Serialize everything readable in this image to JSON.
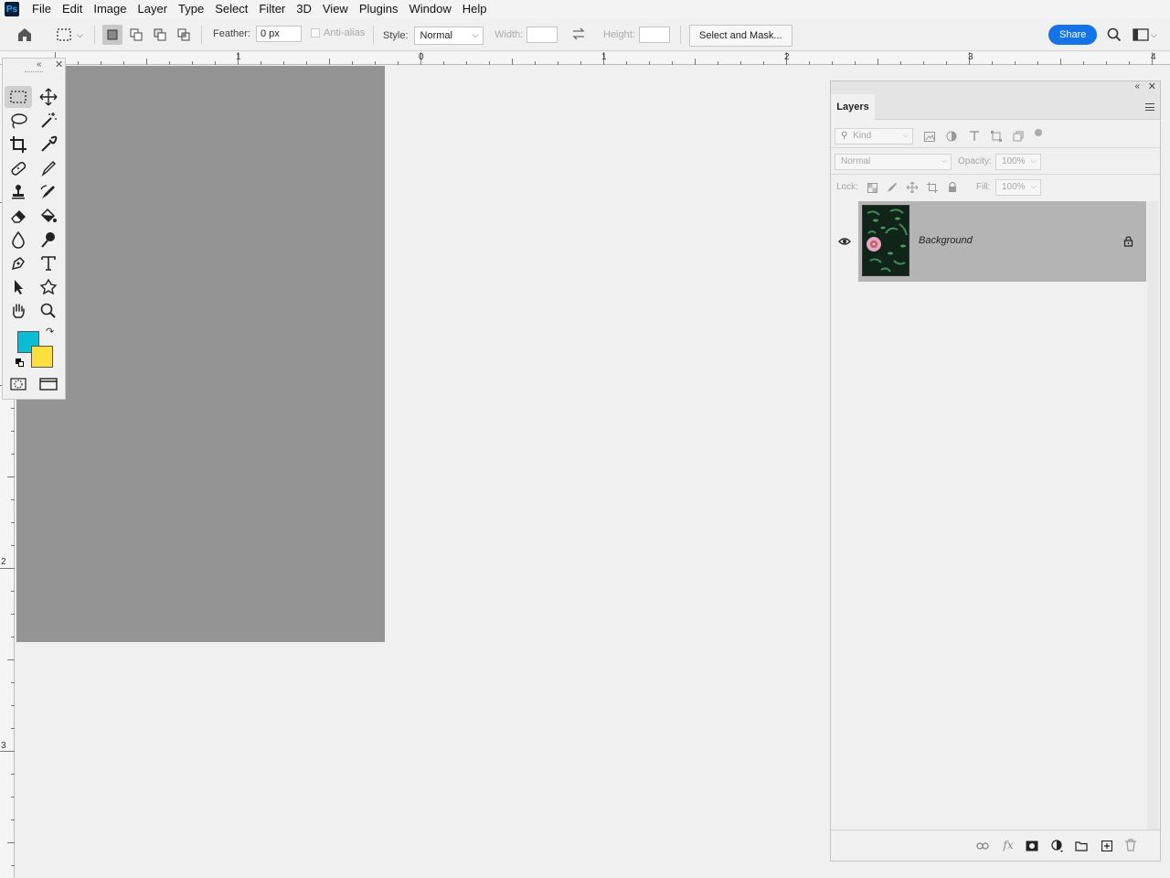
{
  "app": {
    "logo_text": "Ps"
  },
  "menu": [
    "File",
    "Edit",
    "Image",
    "Layer",
    "Type",
    "Select",
    "Filter",
    "3D",
    "View",
    "Plugins",
    "Window",
    "Help"
  ],
  "options": {
    "feather_label": "Feather:",
    "feather_value": "0 px",
    "antialias_label": "Anti-alias",
    "style_label": "Style:",
    "style_value": "Normal",
    "width_label": "Width:",
    "height_label": "Height:",
    "select_mask_label": "Select and Mask...",
    "share_label": "Share"
  },
  "rulers": {
    "top": [
      "1",
      "0",
      "1",
      "2",
      "3",
      "4"
    ],
    "left": [
      "2",
      "3"
    ]
  },
  "colors": {
    "foreground": "#0bbcd4",
    "background": "#fde03c",
    "canvas": "#949494",
    "share_button": "#1473e6"
  },
  "tools": [
    "rectangular-marquee-icon",
    "move-icon",
    "lasso-icon",
    "magic-wand-icon",
    "crop-icon",
    "eyedropper-icon",
    "healing-brush-icon",
    "brush-icon",
    "clone-stamp-icon",
    "history-brush-icon",
    "eraser-icon",
    "paint-bucket-icon",
    "blur-icon",
    "dodge-icon",
    "pen-icon",
    "type-icon",
    "path-selection-icon",
    "custom-shape-icon",
    "hand-icon",
    "zoom-icon"
  ],
  "layers_panel": {
    "tab_label": "Layers",
    "filter_placeholder": "Kind",
    "blend_mode": "Normal",
    "opacity_label": "Opacity:",
    "opacity_value": "100%",
    "lock_label": "Lock:",
    "fill_label": "Fill:",
    "fill_value": "100%",
    "layers": [
      {
        "name": "Background",
        "visible": true,
        "locked": true
      }
    ]
  }
}
